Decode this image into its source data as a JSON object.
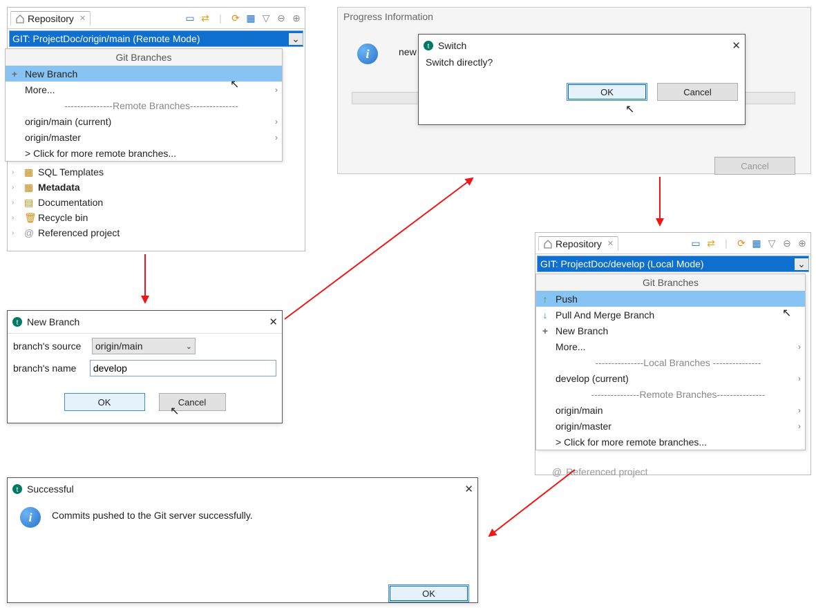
{
  "repo1": {
    "tab_label": "Repository",
    "combo": "GIT: ProjectDoc/origin/main   (Remote Mode)",
    "section": "Git Branches",
    "menu": [
      {
        "icon": "+",
        "label": "New Branch",
        "sel": true
      },
      {
        "icon": "",
        "label": "More...",
        "chev": true
      },
      {
        "icon": "",
        "label": "---------------Remote Branches---------------",
        "divider": true
      },
      {
        "icon": "",
        "label": "origin/main (current)",
        "chev": true
      },
      {
        "icon": "",
        "label": "origin/master",
        "chev": true
      },
      {
        "icon": "",
        "label": "> Click for more remote branches..."
      }
    ],
    "tree": [
      {
        "label": "SQL Templates"
      },
      {
        "label": "Metadata",
        "bold": true
      },
      {
        "label": "Documentation"
      },
      {
        "label": "Recycle bin"
      },
      {
        "label": "Referenced project"
      }
    ]
  },
  "newbranch": {
    "title": "New Branch",
    "source_label": "branch's source",
    "source_value": "origin/main",
    "name_label": "branch's name",
    "name_value": "develop",
    "ok": "OK",
    "cancel": "Cancel"
  },
  "progress": {
    "title": "Progress Information",
    "msg_prefix": "new",
    "cancel": "Cancel",
    "switch_title": "Switch",
    "switch_msg": "Switch directly?",
    "ok": "OK"
  },
  "repo2": {
    "tab_label": "Repository",
    "combo": "GIT: ProjectDoc/develop   (Local Mode)",
    "section": "Git Branches",
    "menu": [
      {
        "icon": "↑",
        "class": "green",
        "label": "Push",
        "sel": true
      },
      {
        "icon": "↓",
        "class": "blue",
        "label": "Pull And Merge Branch"
      },
      {
        "icon": "+",
        "label": "New Branch"
      },
      {
        "icon": "",
        "label": "More...",
        "chev": true
      },
      {
        "icon": "",
        "label": "---------------Local   Branches ---------------",
        "divider": true
      },
      {
        "icon": "",
        "label": "develop (current)",
        "chev": true
      },
      {
        "icon": "",
        "label": "---------------Remote Branches---------------",
        "divider": true
      },
      {
        "icon": "",
        "label": "origin/main",
        "chev": true
      },
      {
        "icon": "",
        "label": "origin/master",
        "chev": true
      },
      {
        "icon": "",
        "label": "> Click for more remote branches..."
      }
    ],
    "tree_after": "Referenced project"
  },
  "success": {
    "title": "Successful",
    "msg": "Commits pushed to the Git server successfully.",
    "ok": "OK"
  }
}
